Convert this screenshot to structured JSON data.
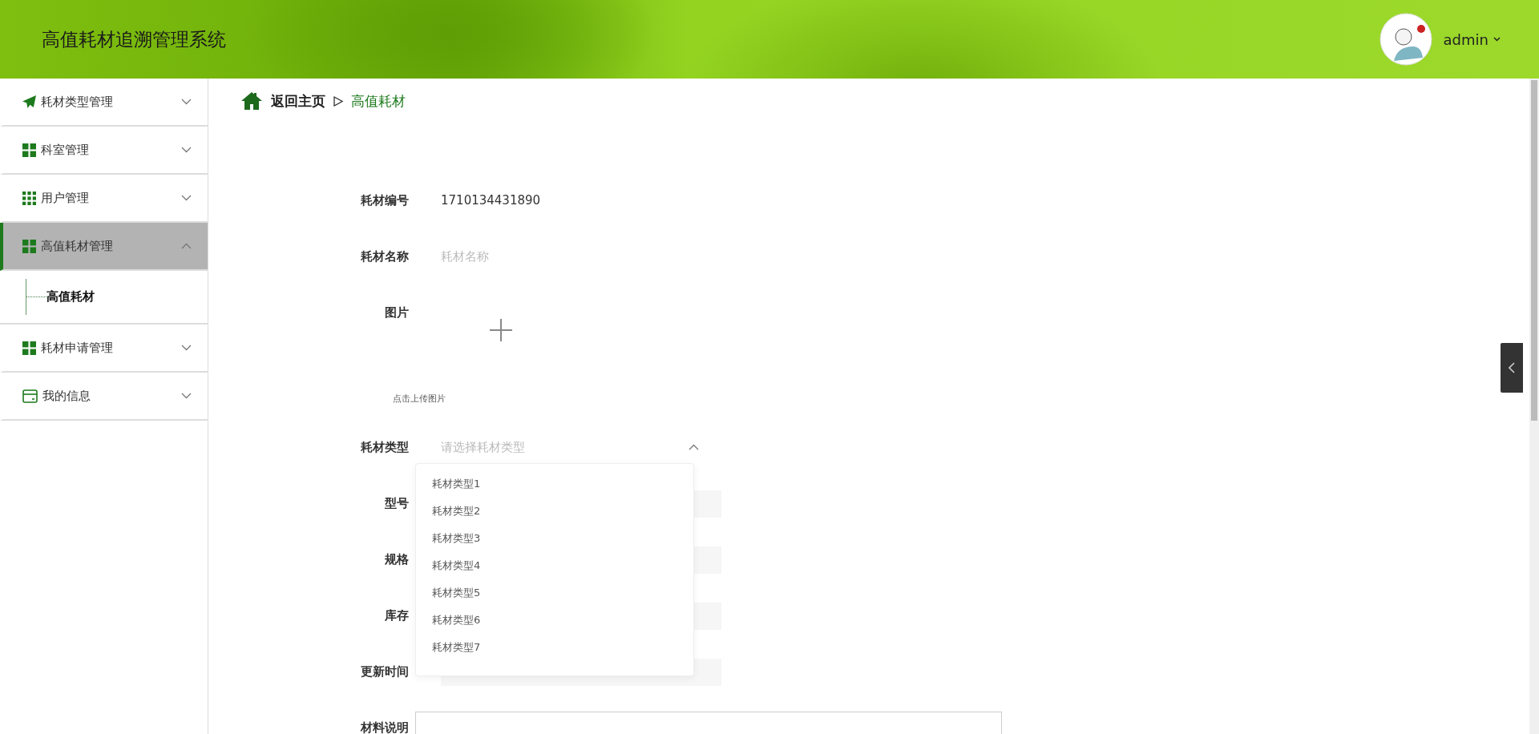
{
  "header": {
    "title": "高值耗材追溯管理系统",
    "user": "admin"
  },
  "sidebar": {
    "items": [
      {
        "label": "耗材类型管理",
        "kind": "send",
        "expanded": false,
        "selected": false
      },
      {
        "label": "科室管理",
        "kind": "grid4",
        "expanded": false,
        "selected": false
      },
      {
        "label": "用户管理",
        "kind": "grid9",
        "expanded": false,
        "selected": false
      },
      {
        "label": "高值耗材管理",
        "kind": "grid4",
        "expanded": true,
        "selected": true,
        "children": [
          {
            "label": "高值耗材",
            "selected": true
          }
        ]
      },
      {
        "label": "耗材申请管理",
        "kind": "grid4",
        "expanded": false,
        "selected": false
      },
      {
        "label": "我的信息",
        "kind": "card",
        "expanded": false,
        "selected": false
      }
    ]
  },
  "breadcrumb": {
    "home": "返回主页",
    "current": "高值耗材"
  },
  "form": {
    "fields": [
      {
        "label": "耗材编号",
        "kind": "text",
        "value": "1710134431890"
      },
      {
        "label": "耗材名称",
        "kind": "input",
        "placeholder": "耗材名称"
      },
      {
        "label": "图片",
        "kind": "upload",
        "hint": "点击上传图片"
      },
      {
        "label": "耗材类型",
        "kind": "select",
        "placeholder": "请选择耗材类型",
        "expanded": true,
        "options": [
          "耗材类型1",
          "耗材类型2",
          "耗材类型3",
          "耗材类型4",
          "耗材类型5",
          "耗材类型6",
          "耗材类型7"
        ]
      },
      {
        "label": "型号",
        "kind": "input"
      },
      {
        "label": "规格",
        "kind": "input"
      },
      {
        "label": "库存",
        "kind": "input"
      },
      {
        "label": "更新时间",
        "kind": "input"
      },
      {
        "label": "材料说明",
        "kind": "editor"
      }
    ]
  }
}
